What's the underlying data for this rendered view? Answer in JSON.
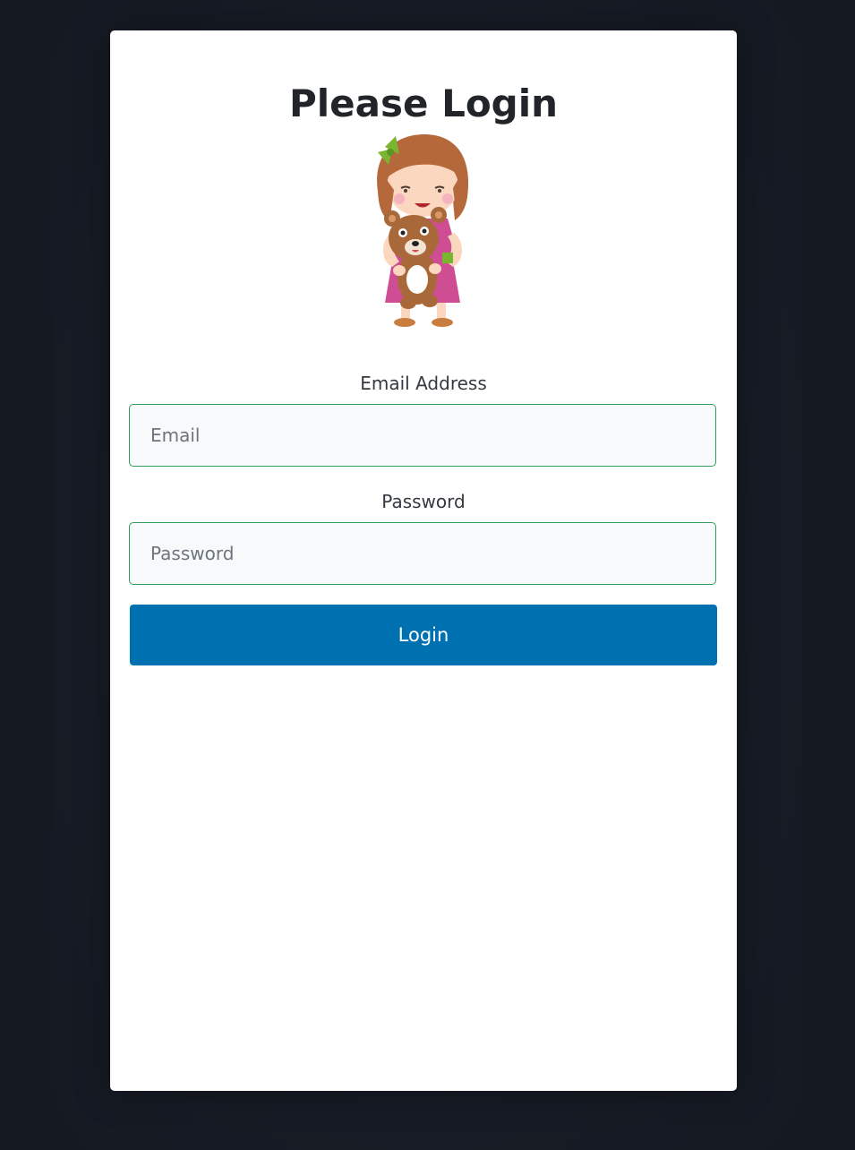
{
  "page": {
    "title": "Please Login"
  },
  "illustration": {
    "icon": "girl-holding-teddy-bear-illustration"
  },
  "form": {
    "email_label": "Email Address",
    "email_placeholder": "Email",
    "email_value": "",
    "password_label": "Password",
    "password_placeholder": "Password",
    "password_value": "",
    "login_label": "Login"
  },
  "colors": {
    "background": "#151922",
    "card": "#ffffff",
    "input_border": "#2fa05a",
    "button": "#0071b0"
  }
}
